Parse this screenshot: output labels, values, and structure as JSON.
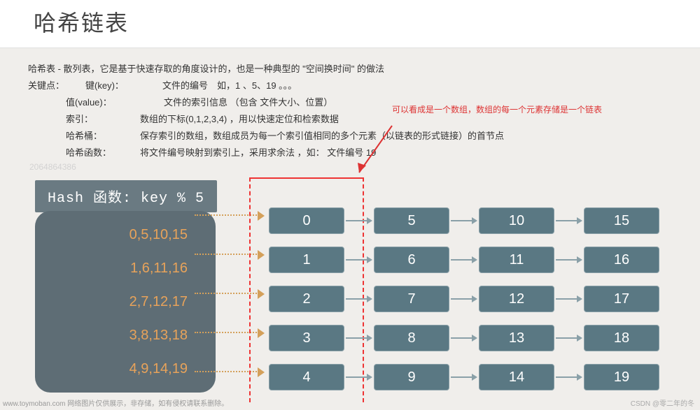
{
  "title": "哈希链表",
  "desc": {
    "intro": "哈希表 - 散列表，它是基于快速存取的角度设计的，也是一种典型的 \"空间换时间\" 的做法",
    "key_label": "关键点：",
    "rows": [
      {
        "k": "键(key)：",
        "v": "文件的编号　如，1 、5、19 。。。"
      },
      {
        "k": "值(value)：",
        "v": "文件的索引信息 （包含 文件大小、位置）"
      },
      {
        "k": "索引：",
        "v": "数组的下标(0,1,2,3,4) ，用以快速定位和检索数据"
      },
      {
        "k": "哈希桶：",
        "v": "保存索引的数组，数组成员为每一个索引值相同的多个元素（以链表的形式链接）的首节点"
      },
      {
        "k": "哈希函数：",
        "v": "将文件编号映射到索引上，采用求余法 ，如： 文件编号 19"
      }
    ]
  },
  "annotation": "可以看成是一个数组，数组的每一个元素存储是一个链表",
  "hash_fn": "Hash 函数: key % 5",
  "groups": [
    "0,5,10,15",
    "1,6,11,16",
    "2,7,12,17",
    "3,8,13,18",
    "4,9,14,19"
  ],
  "chart_data": {
    "type": "table",
    "title": "哈希链表结构",
    "buckets": [
      {
        "index": 0,
        "chain": [
          0,
          5,
          10,
          15
        ]
      },
      {
        "index": 1,
        "chain": [
          1,
          6,
          11,
          16
        ]
      },
      {
        "index": 2,
        "chain": [
          2,
          7,
          12,
          17
        ]
      },
      {
        "index": 3,
        "chain": [
          3,
          8,
          13,
          18
        ]
      },
      {
        "index": 4,
        "chain": [
          4,
          9,
          14,
          19
        ]
      }
    ],
    "hash_function": "key % 5"
  },
  "watermark": "2064864386",
  "footer_left": "www.toymoban.com 网络图片仅供展示，非存储，如有侵权请联系删除。",
  "footer_right": "CSDN @零二年的冬"
}
